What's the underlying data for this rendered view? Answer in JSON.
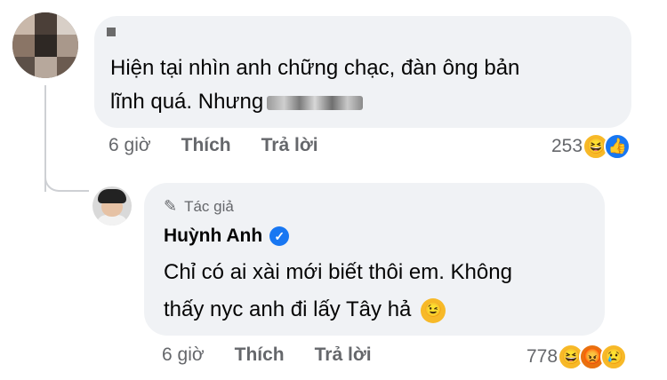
{
  "comment": {
    "text_line1": "Hiện tại nhìn anh chững chạc, đàn ông bản",
    "text_line2": "lĩnh quá. Nhưng",
    "time": "6 giờ",
    "like_label": "Thích",
    "reply_label": "Trả lời",
    "reaction_count": "253",
    "reactions": [
      "haha-emoji-icon",
      "like-icon"
    ]
  },
  "reply": {
    "badge": "Tác giả",
    "author": "Huỳnh Anh",
    "text_line1": "Chỉ có ai xài mới biết thôi em. Không",
    "text_line2": "thấy nyc anh đi lấy Tây hả",
    "time": "6 giờ",
    "like_label": "Thích",
    "reply_label": "Trả lời",
    "reaction_count": "778",
    "reactions": [
      "haha-emoji-icon",
      "angry-emoji-icon",
      "sad-emoji-icon"
    ]
  },
  "colors": {
    "bubble": "#f0f2f5",
    "meta_text": "#65676b",
    "verified": "#1877f2"
  }
}
